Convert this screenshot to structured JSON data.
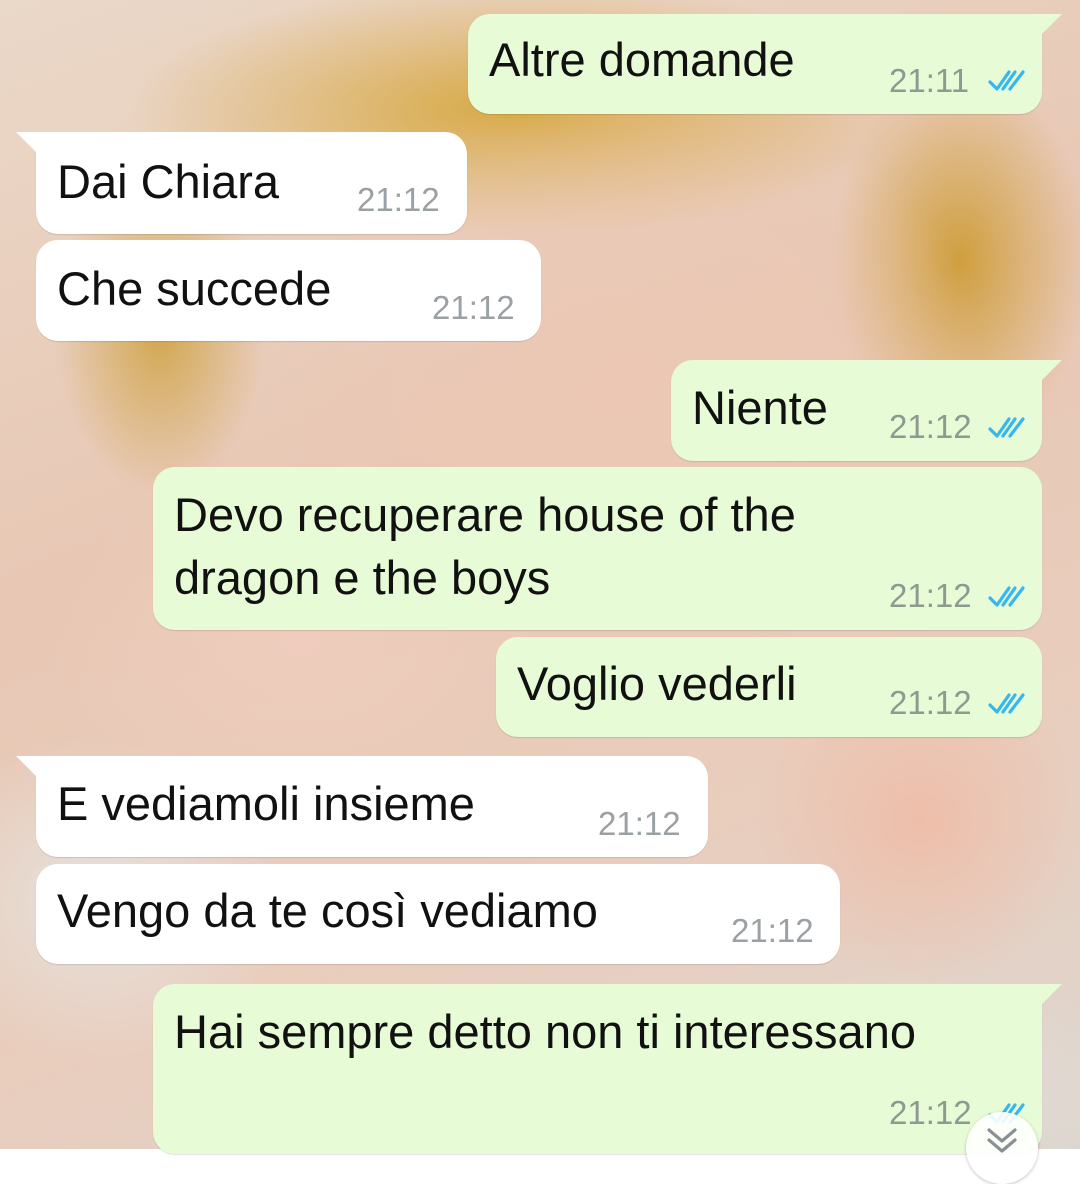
{
  "colors": {
    "outgoing_bubble": "#e7fcd6",
    "incoming_bubble": "#ffffff",
    "read_ticks": "#34b7f1",
    "timestamp": "#8e9a8f"
  },
  "messages": [
    {
      "direction": "out",
      "text_lines": [
        "Altre domande"
      ],
      "time": "21:11",
      "status": "read"
    },
    {
      "direction": "in",
      "text_lines": [
        "Dai Chiara"
      ],
      "time": "21:12"
    },
    {
      "direction": "in",
      "text_lines": [
        "Che succede"
      ],
      "time": "21:12"
    },
    {
      "direction": "out",
      "text_lines": [
        "Niente"
      ],
      "time": "21:12",
      "status": "read"
    },
    {
      "direction": "out",
      "text_lines": [
        "Devo recuperare house of the",
        "dragon e the boys"
      ],
      "time": "21:12",
      "status": "read"
    },
    {
      "direction": "out",
      "text_lines": [
        "Voglio vederli"
      ],
      "time": "21:12",
      "status": "read"
    },
    {
      "direction": "in",
      "text_lines": [
        "E vediamoli insieme"
      ],
      "time": "21:12"
    },
    {
      "direction": "in",
      "text_lines": [
        "Vengo da te così vediamo"
      ],
      "time": "21:12"
    },
    {
      "direction": "out",
      "text_lines": [
        "Hai sempre detto non ti interessano"
      ],
      "time": "21:12",
      "status": "read"
    }
  ],
  "icons": {
    "read_ticks": "double-check-icon",
    "scroll_down": "chevron-double-down-icon"
  }
}
